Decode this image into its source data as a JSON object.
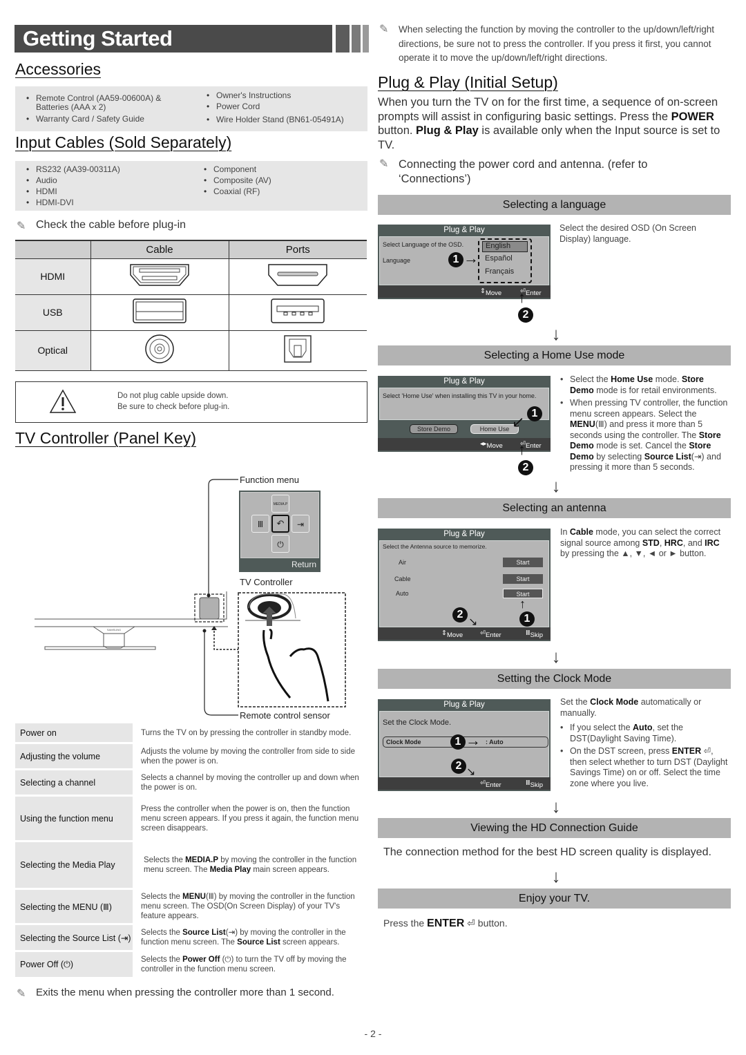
{
  "page": {
    "title": "Getting Started",
    "page_number": "- 2 -"
  },
  "accessories": {
    "heading": "Accessories",
    "col1": [
      "Remote Control (AA59-00600A) & Batteries (AAA x 2)",
      "Warranty Card / Safety Guide"
    ],
    "col2": [
      "Owner's Instructions",
      "Power Cord",
      "Wire Holder Stand (BN61-05491A)"
    ]
  },
  "input_cables": {
    "heading": "Input Cables (Sold Separately)",
    "col1": [
      "RS232 (AA39-00311A)",
      "Audio",
      "HDMI",
      "HDMI-DVI"
    ],
    "col2": [
      "Component",
      "Composite (AV)",
      "Coaxial (RF)"
    ],
    "note": "Check the cable before plug-in"
  },
  "cable_table": {
    "headers": [
      "",
      "Cable",
      "Ports"
    ],
    "rows": [
      {
        "label": "HDMI",
        "cable_icon": "hdmi-plug-icon",
        "port_icon": "hdmi-port-icon"
      },
      {
        "label": "USB",
        "cable_icon": "usb-plug-icon",
        "port_icon": "usb-port-icon"
      },
      {
        "label": "Optical",
        "cable_icon": "optical-plug-icon",
        "port_icon": "optical-port-icon"
      }
    ]
  },
  "warning": {
    "icon": "warning-triangle-icon",
    "line1": "Do not plug cable upside down.",
    "line2": "Be sure to check before plug-in."
  },
  "tv_controller": {
    "heading": "TV Controller (Panel Key)",
    "function_menu_label": "Function menu",
    "media_p": "MEDIA.P",
    "return_label": "Return",
    "tv_controller_label": "TV Controller",
    "remote_sensor_label": "Remote control sensor",
    "brand": "SAMSUNG",
    "keys": [
      {
        "label": "Power on",
        "desc": "Turns the TV on by pressing the controller in standby mode."
      },
      {
        "label": "Adjusting the volume",
        "desc": "Adjusts the volume by moving the controller from side to side when the power is on."
      },
      {
        "label": "Selecting a channel",
        "desc": "Selects a channel by moving the controller up and down when the power is on."
      },
      {
        "label": "Using the function menu",
        "desc": "Press the controller when the power is on, then the function menu screen appears. If you press it again, the function menu screen disappears."
      },
      {
        "label": "Selecting the Media Play",
        "desc_pre": "Selects the ",
        "desc_b1": "MEDIA.P",
        "desc_mid": " by moving the controller in the function menu screen. The ",
        "desc_b2": "Media Play",
        "desc_post": " main screen appears."
      },
      {
        "label": "Selecting the MENU (Ⅲ)",
        "desc_pre": "Selects the ",
        "desc_b1": "MENU",
        "desc_mid": "(Ⅲ) by moving the controller in the function menu screen. The OSD(On Screen Display) of your TV's feature appears."
      },
      {
        "label": "Selecting the Source List (⇥)",
        "desc_pre": "Selects the ",
        "desc_b1": "Source List",
        "desc_mid": "(⇥) by moving the controller in the function menu screen. The ",
        "desc_b2": "Source List",
        "desc_post": " screen appears."
      },
      {
        "label": "Power Off (⏻)",
        "desc_pre": "Selects the ",
        "desc_b1": "Power Off",
        "desc_mid": " (⏻) to turn the TV off by moving the controller in the function menu screen."
      }
    ],
    "exit_note": "Exits the menu when pressing the controller more than 1 second."
  },
  "right_top_note": "When selecting the function by moving the controller to the up/down/left/right directions, be sure not to press the controller. If you press it first, you cannot operate it to move the up/down/left/right directions.",
  "plug_play": {
    "heading": "Plug & Play (Initial Setup)",
    "intro_1": "When you turn the TV on for the first time, a sequence of on-screen prompts will assist in configuring basic settings. Press the ",
    "intro_power": "POWER",
    "intro_2": " button. ",
    "intro_pp": "Plug & Play",
    "intro_3": " is available only when the Input source is set to TV.",
    "note": "Connecting the power cord and antenna. (refer to ‘Connections’)",
    "osd_title": "Plug & Play",
    "steps": {
      "language": {
        "bar": "Selecting a language",
        "osd_prompt": "Select Language of the OSD.",
        "osd_field": "Language",
        "options": [
          "English",
          "Español",
          "Français"
        ],
        "selected": "English",
        "foot_move": "Move",
        "foot_enter": "Enter",
        "desc": "Select the desired OSD (On Screen Display) language."
      },
      "home_use": {
        "bar": "Selecting a Home Use mode",
        "osd_prompt": "Select 'Home Use' when installing this TV in your home.",
        "btn_store": "Store Demo",
        "btn_home": "Home Use",
        "foot_move": "Move",
        "foot_enter": "Enter",
        "b1_pre": "Select the ",
        "b1_bold1": "Home Use",
        "b1_mid": " mode. ",
        "b1_bold2": "Store Demo",
        "b1_post": " mode is for retail environments.",
        "b2_a": "When pressing TV controller, the function menu screen appears. Select the ",
        "b2_menu": "MENU",
        "b2_b": "(Ⅲ) and press it more than 5 seconds using the controller. The ",
        "b2_sd1": "Store Demo",
        "b2_c": " mode is set. Cancel the ",
        "b2_sd2": "Store Demo",
        "b2_d": " by selecting ",
        "b2_sl": "Source List",
        "b2_e": "(⇥) and pressing it more than 5 seconds."
      },
      "antenna": {
        "bar": "Selecting an antenna",
        "osd_prompt": "Select the Antenna source to memorize.",
        "rows": [
          {
            "name": "Air",
            "btn": "Start"
          },
          {
            "name": "Cable",
            "btn": "Start"
          },
          {
            "name": "Auto",
            "btn": "Start"
          }
        ],
        "foot_move": "Move",
        "foot_enter": "Enter",
        "foot_skip": "Skip",
        "d_pre": "In ",
        "d_cable": "Cable",
        "d_mid": " mode, you can select the correct signal source among ",
        "d_std": "STD",
        "d_c1": ", ",
        "d_hrc": "HRC",
        "d_c2": ", and ",
        "d_irc": "IRC",
        "d_post": " by pressing the ▲, ▼, ◄ or ► button."
      },
      "clock": {
        "bar": "Setting the Clock Mode",
        "osd_prompt": "Set the Clock Mode.",
        "field": "Clock Mode",
        "value": ": Auto",
        "foot_enter": "Enter",
        "foot_skip": "Skip",
        "d_pre": "Set the ",
        "d_b": "Clock Mode",
        "d_post": " automatically or manually.",
        "b1_pre": "If you select the ",
        "b1_b": "Auto",
        "b1_post": ", set the DST(Daylight Saving Time).",
        "b2_pre": "On the DST screen, press ",
        "b2_b": "ENTER",
        "b2_post": ", then select whether to turn DST (Daylight Savings Time) on or off. Select the time zone where you live."
      },
      "hd_guide": {
        "bar": "Viewing the HD Connection Guide",
        "desc": "The connection method for the best HD screen quality is displayed."
      },
      "enjoy": {
        "bar": "Enjoy your TV.",
        "d_pre": "Press the ",
        "d_b": "ENTER",
        "d_post": " button."
      }
    }
  }
}
